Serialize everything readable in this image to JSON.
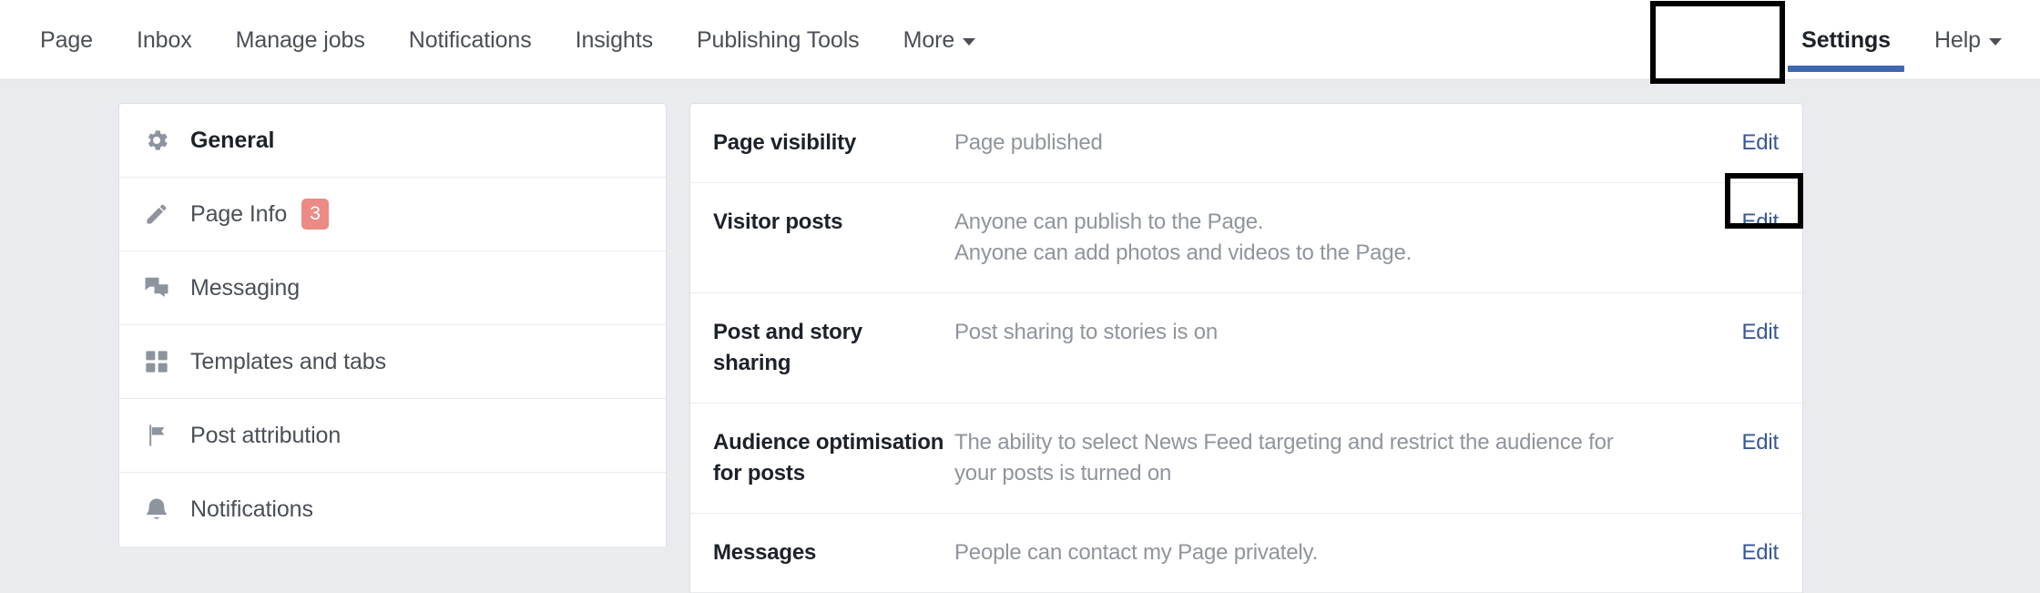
{
  "nav": {
    "left_items": [
      {
        "label": "Page",
        "icon": "",
        "caret": false,
        "active": false
      },
      {
        "label": "Inbox",
        "icon": "",
        "caret": false,
        "active": false
      },
      {
        "label": "Manage jobs",
        "icon": "",
        "caret": false,
        "active": false
      },
      {
        "label": "Notifications",
        "icon": "",
        "caret": false,
        "active": false
      },
      {
        "label": "Insights",
        "icon": "",
        "caret": false,
        "active": false
      },
      {
        "label": "Publishing Tools",
        "icon": "",
        "caret": false,
        "active": false
      },
      {
        "label": "More",
        "icon": "chevron-down-icon",
        "caret": true,
        "active": false
      }
    ],
    "right_items": [
      {
        "label": "Settings",
        "icon": "",
        "caret": false,
        "active": true
      },
      {
        "label": "Help",
        "icon": "chevron-down-icon",
        "caret": true,
        "active": false
      }
    ],
    "active_underline_color": "#4267b2"
  },
  "sidebar": {
    "items": [
      {
        "label": "General",
        "icon": "gear-icon",
        "current": true,
        "badge": ""
      },
      {
        "label": "Page Info",
        "icon": "pencil-icon",
        "current": false,
        "badge": "3"
      },
      {
        "label": "Messaging",
        "icon": "chat-bubbles-icon",
        "current": false,
        "badge": ""
      },
      {
        "label": "Templates and tabs",
        "icon": "grid-squares-icon",
        "current": false,
        "badge": ""
      },
      {
        "label": "Post attribution",
        "icon": "flag-icon",
        "current": false,
        "badge": ""
      },
      {
        "label": "Notifications",
        "icon": "bell-icon",
        "current": false,
        "badge": ""
      }
    ],
    "badge_color": "#ec8b85"
  },
  "content": {
    "edit_label": "Edit",
    "rows": [
      {
        "title": "Page visibility",
        "desc_lines": [
          "Page published"
        ],
        "edit": "Edit"
      },
      {
        "title": "Visitor posts",
        "desc_lines": [
          "Anyone can publish to the Page.",
          "Anyone can add photos and videos to the Page."
        ],
        "edit": "Edit"
      },
      {
        "title": "Post and story sharing",
        "desc_lines": [
          "Post sharing to stories is on"
        ],
        "edit": "Edit"
      },
      {
        "title": "Audience optimisation for posts",
        "desc_lines": [
          "The ability to select News Feed targeting and restrict the audience for",
          "your posts is turned on"
        ],
        "edit": "Edit"
      },
      {
        "title": "Messages",
        "desc_lines": [
          "People can contact my Page privately."
        ],
        "edit": "Edit"
      }
    ]
  },
  "annotations": {
    "settings_tab_box_color": "#000000",
    "visitor_posts_edit_box_color": "#000000"
  }
}
